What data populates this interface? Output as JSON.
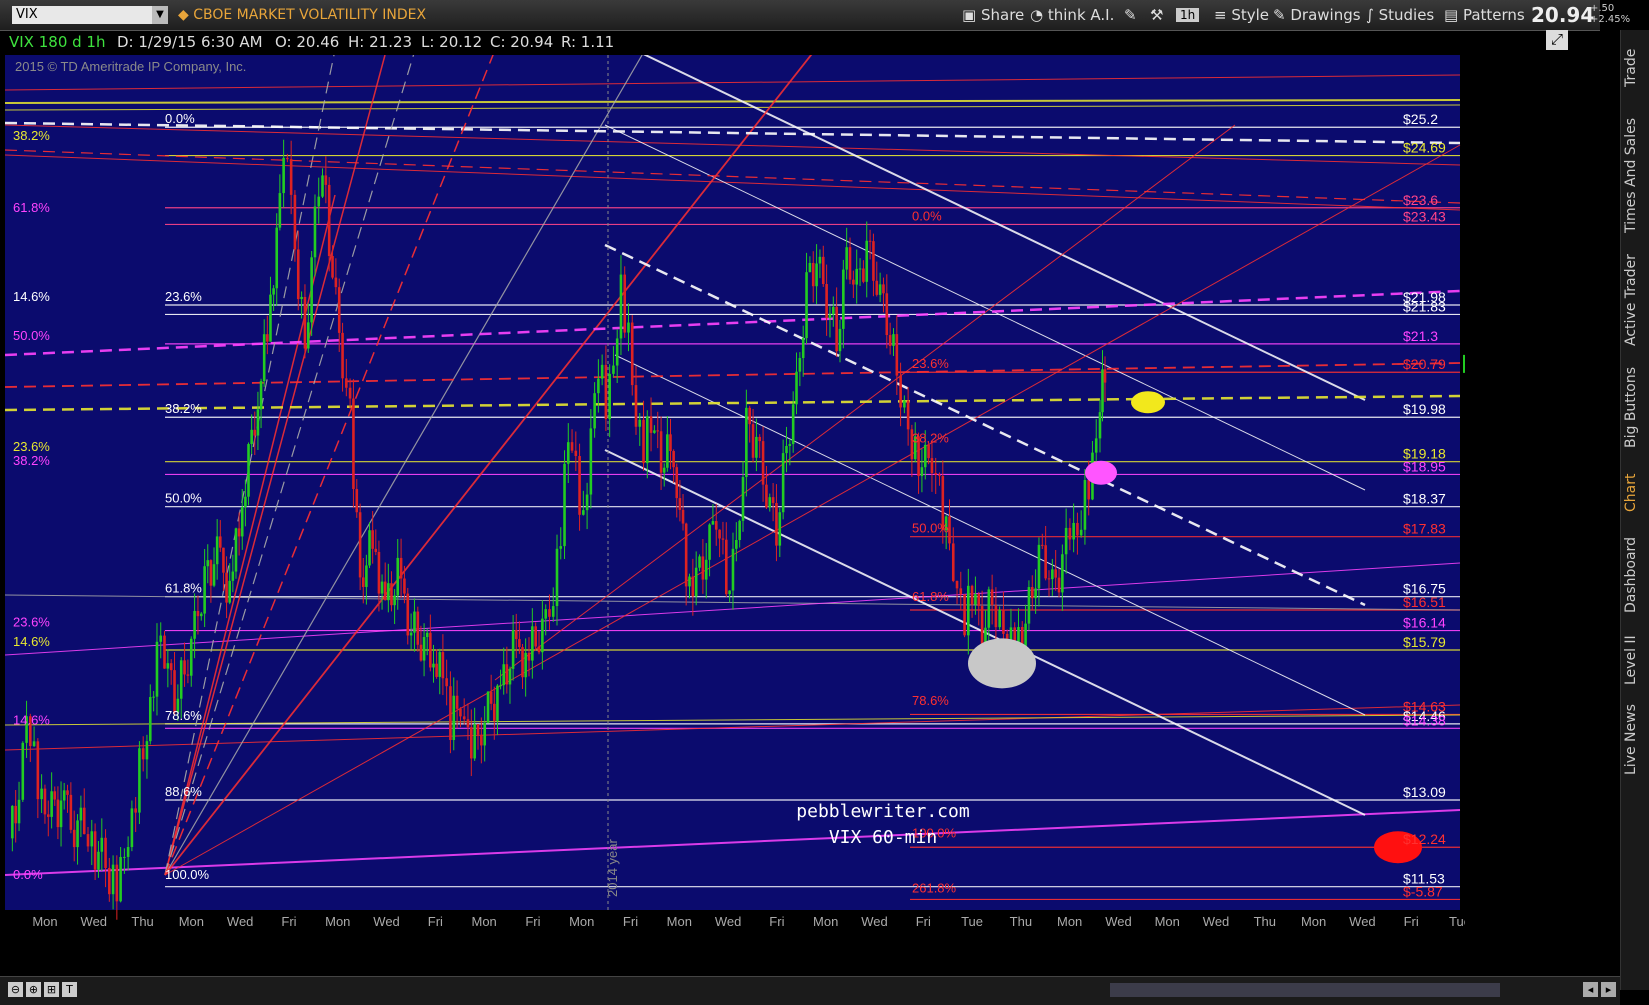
{
  "toolbar": {
    "symbol": "VIX",
    "title": "CBOE MARKET VOLATILITY INDEX",
    "buttons": [
      "Share",
      "think A.I.",
      "1h",
      "Style",
      "Drawings",
      "Studies",
      "Patterns"
    ],
    "last_price": "20.94",
    "change": "+.50",
    "change_pct": "+2.45%"
  },
  "info": {
    "study": "VIX 180 d 1h",
    "date": "D: 1/29/15 6:30 AM",
    "open": "O: 20.46",
    "high": "H: 21.23",
    "low": "L: 20.12",
    "close": "C: 20.94",
    "range": "R: 1.11",
    "copyright": "2015 © TD Ameritrade IP Company, Inc."
  },
  "side_tabs": [
    "Trade",
    "Times And Sales",
    "Active Trader",
    "Big Buttons",
    "Chart",
    "Dashboard",
    "Level II",
    "Live News"
  ],
  "colors": {
    "background": "#0b0b6e",
    "up": "#22cc22",
    "down": "#dd2222",
    "fib_red": "#ff3030",
    "magenta": "#ff44ff",
    "yellow": "#e8e830",
    "white": "#ffffff",
    "accent": "#e8a53a"
  },
  "annotation": {
    "line1": "pebblewriter.com",
    "line2": "VIX 60-min"
  },
  "year_label": "2014 year",
  "chart_data": {
    "type": "candlestick",
    "title": "CBOE MARKET VOLATILITY INDEX",
    "ylim": [
      11.2,
      26.5
    ],
    "y_ticks": [
      12,
      13,
      14,
      15,
      16,
      17,
      18,
      19,
      20,
      21,
      22,
      23,
      24,
      25,
      26
    ],
    "x_tick_labels": [
      "Mon",
      "Wed",
      "Thu",
      "Mon",
      "Wed",
      "Fri",
      "Mon",
      "Wed",
      "Fri",
      "Mon",
      "Fri",
      "Mon",
      "Fri",
      "Mon",
      "Wed",
      "Fri",
      "Mon",
      "Wed",
      "Fri",
      "Tue",
      "Thu",
      "Mon",
      "Wed",
      "Mon",
      "Wed",
      "Thu",
      "Mon",
      "Wed",
      "Fri",
      "Tue"
    ],
    "level_labels": [
      {
        "text": "$25.2",
        "value": 25.2,
        "color": "#ffffff"
      },
      {
        "text": "$24.69",
        "value": 24.69,
        "color": "#e8e830"
      },
      {
        "text": "$23.6",
        "value": 23.75,
        "color": "#ff4488"
      },
      {
        "text": "$23.43",
        "value": 23.45,
        "color": "#ff4488"
      },
      {
        "text": "$21.98",
        "value": 22.0,
        "color": "#ffffff"
      },
      {
        "text": "$21.83",
        "value": 21.83,
        "color": "#ffffff"
      },
      {
        "text": "$21.3",
        "value": 21.3,
        "color": "#ff44ff"
      },
      {
        "text": "$20.79",
        "value": 20.79,
        "color": "#ff3030"
      },
      {
        "text": "$19.98",
        "value": 19.98,
        "color": "#ffffff"
      },
      {
        "text": "$19.18",
        "value": 19.18,
        "color": "#e8e830"
      },
      {
        "text": "$18.95",
        "value": 18.95,
        "color": "#ff44ff"
      },
      {
        "text": "$18.37",
        "value": 18.37,
        "color": "#ffffff"
      },
      {
        "text": "$17.83",
        "value": 17.83,
        "color": "#ff3030"
      },
      {
        "text": "$16.75",
        "value": 16.75,
        "color": "#ffffff"
      },
      {
        "text": "$16.51",
        "value": 16.51,
        "color": "#ff3030"
      },
      {
        "text": "$16.14",
        "value": 16.14,
        "color": "#ff44ff"
      },
      {
        "text": "$15.79",
        "value": 15.79,
        "color": "#e8e830"
      },
      {
        "text": "$14.63",
        "value": 14.63,
        "color": "#ff3030"
      },
      {
        "text": "$14.46",
        "value": 14.46,
        "color": "#ffffff"
      },
      {
        "text": "$14.38",
        "value": 14.38,
        "color": "#ff44ff"
      },
      {
        "text": "$13.09",
        "value": 13.09,
        "color": "#ffffff"
      },
      {
        "text": "$12.24",
        "value": 12.24,
        "color": "#ff3030"
      },
      {
        "text": "$11.53",
        "value": 11.53,
        "color": "#ffffff"
      },
      {
        "text": "$-5.87",
        "value": 11.3,
        "color": "#ff3030"
      }
    ],
    "fib_labels": [
      {
        "text": "0.0%",
        "value": 25.2,
        "color": "#ffffff",
        "pos": "left2"
      },
      {
        "text": "38.2%",
        "value": 24.9,
        "color": "#e8e830",
        "pos": "left"
      },
      {
        "text": "61.8%",
        "value": 23.6,
        "color": "#ff44ff",
        "pos": "left"
      },
      {
        "text": "14.6%",
        "value": 22.0,
        "color": "#ffffff",
        "pos": "left"
      },
      {
        "text": "23.6%",
        "value": 22.0,
        "color": "#ffffff",
        "pos": "left2"
      },
      {
        "text": "50.0%",
        "value": 21.3,
        "color": "#ff44ff",
        "pos": "left"
      },
      {
        "text": "38.2%",
        "value": 19.98,
        "color": "#ffffff",
        "pos": "left2"
      },
      {
        "text": "23.6%",
        "value": 19.3,
        "color": "#e8e830",
        "pos": "left"
      },
      {
        "text": "38.2%",
        "value": 19.05,
        "color": "#ff44ff",
        "pos": "left"
      },
      {
        "text": "50.0%",
        "value": 18.37,
        "color": "#ffffff",
        "pos": "left2"
      },
      {
        "text": "61.8%",
        "value": 16.75,
        "color": "#ffffff",
        "pos": "left2"
      },
      {
        "text": "23.6%",
        "value": 16.14,
        "color": "#ff44ff",
        "pos": "left"
      },
      {
        "text": "14.6%",
        "value": 15.79,
        "color": "#e8e830",
        "pos": "left"
      },
      {
        "text": "78.6%",
        "value": 14.46,
        "color": "#ffffff",
        "pos": "left2"
      },
      {
        "text": "14.6%",
        "value": 14.38,
        "color": "#ff44ff",
        "pos": "left"
      },
      {
        "text": "88.6%",
        "value": 13.09,
        "color": "#ffffff",
        "pos": "left2"
      },
      {
        "text": "0.0%",
        "value": 11.6,
        "color": "#ff44ff",
        "pos": "left"
      },
      {
        "text": "100.0%",
        "value": 11.6,
        "color": "#ffffff",
        "pos": "left2"
      },
      {
        "text": "0.0%",
        "value": 23.45,
        "color": "#ff3030",
        "pos": "mid"
      },
      {
        "text": "23.6%",
        "value": 20.79,
        "color": "#ff3030",
        "pos": "mid"
      },
      {
        "text": "38.2%",
        "value": 19.45,
        "color": "#ff3030",
        "pos": "mid"
      },
      {
        "text": "50.0%",
        "value": 17.83,
        "color": "#ff3030",
        "pos": "mid"
      },
      {
        "text": "61.8%",
        "value": 16.6,
        "color": "#ff3030",
        "pos": "mid"
      },
      {
        "text": "78.6%",
        "value": 14.73,
        "color": "#ff3030",
        "pos": "mid"
      },
      {
        "text": "100.0%",
        "value": 12.34,
        "color": "#ff3030",
        "pos": "mid"
      },
      {
        "text": "261.8%",
        "value": 11.35,
        "color": "#ff3030",
        "pos": "mid"
      }
    ],
    "last_value": 20.94,
    "path_points": [
      [
        0,
        12.4
      ],
      [
        8,
        13.2
      ],
      [
        14,
        14.5
      ],
      [
        20,
        13.8
      ],
      [
        26,
        13.1
      ],
      [
        34,
        12.9
      ],
      [
        44,
        13.0
      ],
      [
        52,
        12.5
      ],
      [
        60,
        12.8
      ],
      [
        66,
        12.2
      ],
      [
        74,
        12.1
      ],
      [
        80,
        11.7
      ],
      [
        86,
        11.55
      ],
      [
        92,
        12.0
      ],
      [
        98,
        12.6
      ],
      [
        104,
        13.8
      ],
      [
        110,
        14.3
      ],
      [
        118,
        15.8
      ],
      [
        124,
        15.6
      ],
      [
        132,
        15.0
      ],
      [
        140,
        15.4
      ],
      [
        148,
        16.2
      ],
      [
        156,
        17.0
      ],
      [
        166,
        17.5
      ],
      [
        176,
        16.8
      ],
      [
        186,
        18.5
      ],
      [
        196,
        20.0
      ],
      [
        206,
        21.5
      ],
      [
        216,
        23.8
      ],
      [
        222,
        24.8
      ],
      [
        228,
        22.8
      ],
      [
        236,
        21.3
      ],
      [
        244,
        23.5
      ],
      [
        250,
        24.6
      ],
      [
        258,
        22.5
      ],
      [
        266,
        21.0
      ],
      [
        272,
        20.0
      ],
      [
        280,
        17.0
      ],
      [
        290,
        17.8
      ],
      [
        300,
        16.5
      ],
      [
        310,
        17.1
      ],
      [
        318,
        16.4
      ],
      [
        326,
        16.0
      ],
      [
        336,
        15.8
      ],
      [
        346,
        15.3
      ],
      [
        352,
        14.5
      ],
      [
        360,
        14.9
      ],
      [
        366,
        14.1
      ],
      [
        374,
        14.2
      ],
      [
        382,
        14.7
      ],
      [
        392,
        15.0
      ],
      [
        402,
        15.8
      ],
      [
        412,
        15.6
      ],
      [
        420,
        16.0
      ],
      [
        428,
        16.3
      ],
      [
        434,
        16.8
      ],
      [
        440,
        18.0
      ],
      [
        446,
        19.6
      ],
      [
        452,
        19.0
      ],
      [
        458,
        18.0
      ],
      [
        464,
        19.8
      ],
      [
        470,
        21.0
      ],
      [
        476,
        20.2
      ],
      [
        482,
        20.8
      ],
      [
        488,
        22.2
      ],
      [
        494,
        21.5
      ],
      [
        500,
        20.0
      ],
      [
        506,
        19.5
      ],
      [
        512,
        19.8
      ],
      [
        520,
        19.3
      ],
      [
        530,
        19.4
      ],
      [
        540,
        17.2
      ],
      [
        548,
        17.0
      ],
      [
        556,
        17.5
      ],
      [
        564,
        18.3
      ],
      [
        572,
        17.0
      ],
      [
        580,
        17.6
      ],
      [
        588,
        19.8
      ],
      [
        596,
        19.5
      ],
      [
        604,
        18.6
      ],
      [
        612,
        18.0
      ],
      [
        620,
        19.5
      ],
      [
        628,
        20.5
      ],
      [
        636,
        22.3
      ],
      [
        644,
        22.8
      ],
      [
        652,
        22.1
      ],
      [
        660,
        21.4
      ],
      [
        668,
        22.9
      ],
      [
        676,
        22.3
      ],
      [
        684,
        23.0
      ],
      [
        692,
        22.4
      ],
      [
        700,
        21.8
      ],
      [
        708,
        20.8
      ],
      [
        714,
        20.2
      ],
      [
        720,
        19.5
      ],
      [
        728,
        19.1
      ],
      [
        736,
        19.3
      ],
      [
        742,
        18.6
      ],
      [
        750,
        17.6
      ],
      [
        756,
        17.0
      ],
      [
        762,
        16.4
      ],
      [
        768,
        16.8
      ],
      [
        776,
        16.2
      ],
      [
        784,
        16.7
      ],
      [
        790,
        16.4
      ],
      [
        796,
        16.0
      ],
      [
        802,
        15.9
      ],
      [
        808,
        15.85
      ],
      [
        816,
        17.0
      ],
      [
        824,
        17.6
      ],
      [
        832,
        16.9
      ],
      [
        840,
        17.3
      ],
      [
        846,
        18.0
      ],
      [
        852,
        17.7
      ],
      [
        858,
        18.5
      ],
      [
        864,
        19.2
      ],
      [
        870,
        20.3
      ],
      [
        874,
        20.94
      ]
    ]
  }
}
